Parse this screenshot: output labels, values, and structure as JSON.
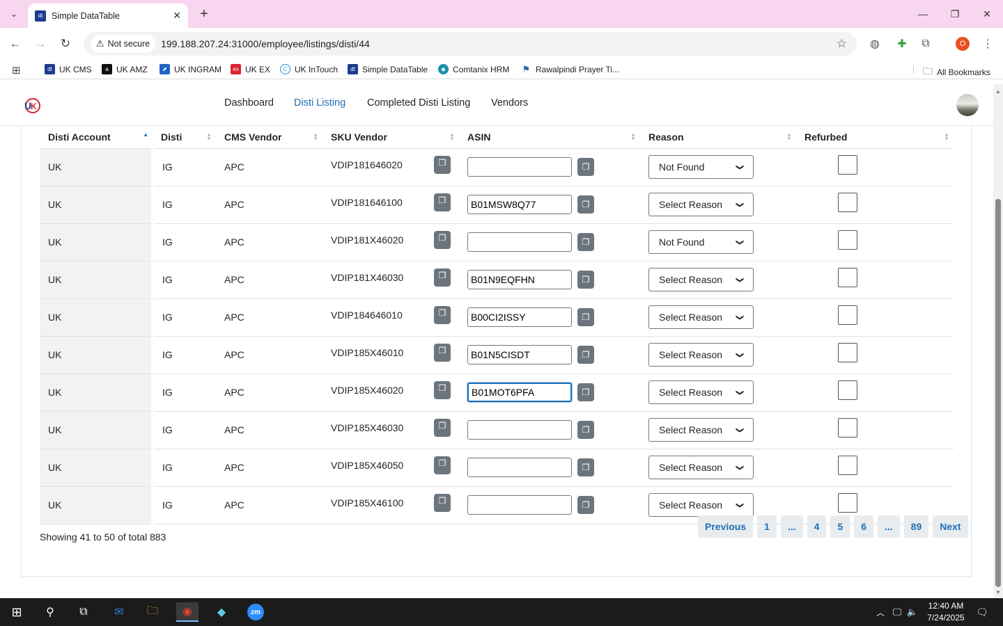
{
  "browser": {
    "tab_title": "Simple DataTable",
    "not_secure_label": "Not secure",
    "url": "199.188.207.24:31000/employee/listings/disti/44",
    "profile_initial": "O",
    "bookmarks": [
      {
        "label": "UK CMS"
      },
      {
        "label": "UK AMZ"
      },
      {
        "label": "UK INGRAM"
      },
      {
        "label": "UK EX"
      },
      {
        "label": "UK InTouch"
      },
      {
        "label": "Simple DataTable"
      },
      {
        "label": "Comtanix HRM"
      },
      {
        "label": "Rawalpindi Prayer Ti..."
      }
    ],
    "all_bookmarks": "All Bookmarks"
  },
  "nav": {
    "links": [
      {
        "label": "Dashboard"
      },
      {
        "label": "Disti Listing"
      },
      {
        "label": "Completed Disti Listing"
      },
      {
        "label": "Vendors"
      }
    ],
    "active": "Disti Listing"
  },
  "table": {
    "columns": [
      "Disti Account",
      "Disti",
      "CMS Vendor",
      "SKU Vendor",
      "ASIN",
      "Reason",
      "Refurbed"
    ],
    "sorted_column": "Disti Account",
    "rows": [
      {
        "account": "UK",
        "disti": "IG",
        "vendor": "APC",
        "sku": "VDIP181646020",
        "asin": "",
        "reason": "Not Found"
      },
      {
        "account": "UK",
        "disti": "IG",
        "vendor": "APC",
        "sku": "VDIP181646100",
        "asin": "B01MSW8Q77",
        "reason": "Select Reason"
      },
      {
        "account": "UK",
        "disti": "IG",
        "vendor": "APC",
        "sku": "VDIP181X46020",
        "asin": "",
        "reason": "Not Found"
      },
      {
        "account": "UK",
        "disti": "IG",
        "vendor": "APC",
        "sku": "VDIP181X46030",
        "asin": "B01N9EQFHN",
        "reason": "Select Reason"
      },
      {
        "account": "UK",
        "disti": "IG",
        "vendor": "APC",
        "sku": "VDIP184646010",
        "asin": "B00CI2ISSY",
        "reason": "Select Reason"
      },
      {
        "account": "UK",
        "disti": "IG",
        "vendor": "APC",
        "sku": "VDIP185X46010",
        "asin": "B01N5CISDT",
        "reason": "Select Reason"
      },
      {
        "account": "UK",
        "disti": "IG",
        "vendor": "APC",
        "sku": "VDIP185X46020",
        "asin": "B01MOT6PFA",
        "reason": "Select Reason"
      },
      {
        "account": "UK",
        "disti": "IG",
        "vendor": "APC",
        "sku": "VDIP185X46030",
        "asin": "",
        "reason": "Select Reason"
      },
      {
        "account": "UK",
        "disti": "IG",
        "vendor": "APC",
        "sku": "VDIP185X46050",
        "asin": "",
        "reason": "Select Reason"
      },
      {
        "account": "UK",
        "disti": "IG",
        "vendor": "APC",
        "sku": "VDIP185X46100",
        "asin": "",
        "reason": "Select Reason"
      }
    ]
  },
  "pagination": {
    "showing": "Showing 41 to 50 of total 883",
    "items": [
      "Previous",
      "1",
      "...",
      "4",
      "5",
      "6",
      "...",
      "89",
      "Next"
    ]
  },
  "taskbar": {
    "time": "12:40 AM",
    "date": "7/24/2025"
  },
  "colors": {
    "accent": "#1e6fb5",
    "tabbar": "#f9d6ef",
    "copy_button": "#6c757d"
  }
}
